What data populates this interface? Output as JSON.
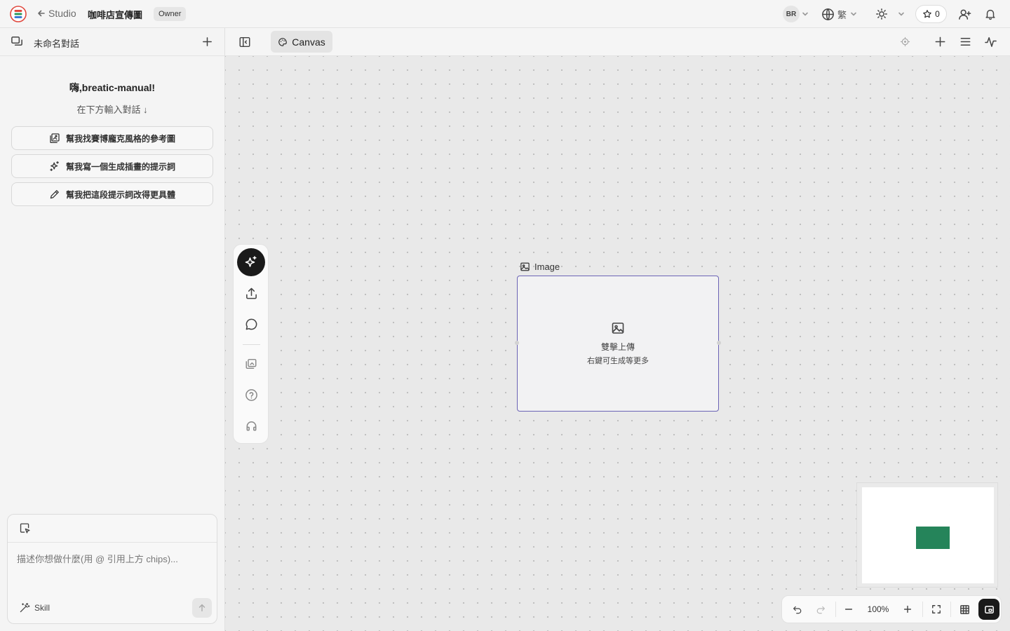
{
  "app": {
    "back_label": "Studio",
    "project_title": "咖啡店宣傳圖",
    "role_badge": "Owner"
  },
  "header_right": {
    "user_initials": "BR",
    "language": "繁",
    "stars_count": "0",
    "icons": [
      "avatar-badge",
      "globe-icon",
      "sun-icon",
      "chevron-down-icon",
      "star-icon",
      "add-user-icon",
      "bell-icon"
    ]
  },
  "sidebar": {
    "conversation_title": "未命名對話",
    "greeting": "嗨,breatic-manual!",
    "subtitle": "在下方輸入對話 ↓",
    "suggestions": [
      {
        "label": "幫我找賽博龐克風格的參考圖",
        "icon": "image-search-icon"
      },
      {
        "label": "幫我寫一個生成插畫的提示詞",
        "icon": "sparkles-icon"
      },
      {
        "label": "幫我把這段提示詞改得更具體",
        "icon": "pencil-icon"
      }
    ],
    "chat_input_placeholder": "描述你想做什麼(用 @ 引用上方 chips)...",
    "skill_label": "Skill"
  },
  "canvas": {
    "tab_label": "Canvas",
    "node": {
      "title": "Image",
      "line1": "雙擊上傳",
      "line2": "右鍵可生成等更多"
    },
    "zoom_level": "100%",
    "colors": {
      "node_border": "#6b63b5",
      "minimap_block": "#25845a"
    }
  }
}
